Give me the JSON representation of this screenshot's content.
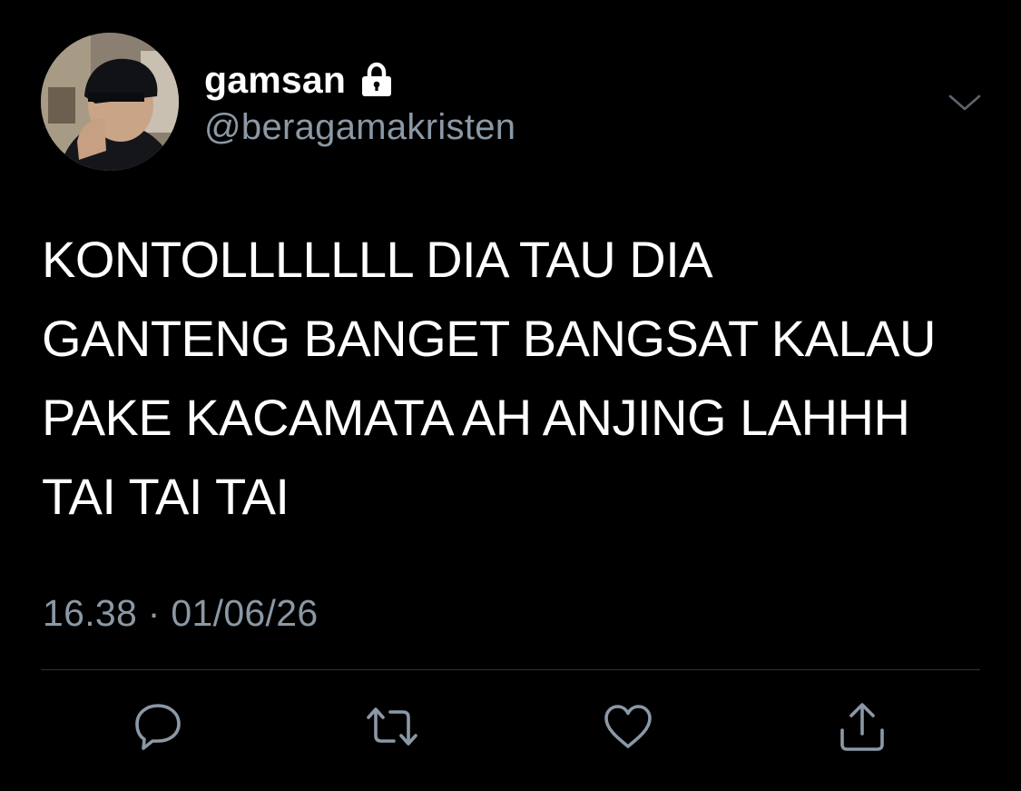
{
  "user": {
    "display_name": "gamsan",
    "handle": "@beragamakristen",
    "protected_icon": "lock-icon"
  },
  "tweet": {
    "text": "KONTOLLLLLLL DIA TAU DIA\nGANTENG BANGET BANGSAT KALAU\nPAKE KACAMATA AH ANJING LAHHH\nTAI TAI TAI",
    "timestamp": "16.38 · 01/06/26"
  },
  "actions": [
    {
      "name": "reply",
      "icon": "reply-icon"
    },
    {
      "name": "retweet",
      "icon": "retweet-icon"
    },
    {
      "name": "like",
      "icon": "heart-icon"
    },
    {
      "name": "share",
      "icon": "share-icon"
    }
  ],
  "colors": {
    "background": "#000000",
    "text": "#ffffff",
    "secondary": "#8b98a5",
    "divider": "#2f3336"
  }
}
